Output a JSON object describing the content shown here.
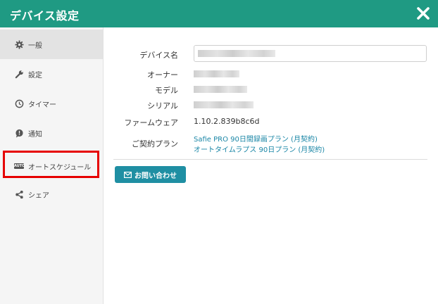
{
  "window": {
    "title": "デバイス設定"
  },
  "sidebar": {
    "items": [
      {
        "label": "一般",
        "icon": "gear-icon",
        "active": true
      },
      {
        "label": "設定",
        "icon": "wrench-icon"
      },
      {
        "label": "タイマー",
        "icon": "clock-icon"
      },
      {
        "label": "通知",
        "icon": "notification-icon"
      },
      {
        "label": "オートスケジュール",
        "icon": "auto-icon",
        "icon_text": "AUTO"
      },
      {
        "label": "シェア",
        "icon": "share-icon"
      }
    ]
  },
  "general": {
    "device_name_label": "デバイス名",
    "owner_label": "オーナー",
    "model_label": "モデル",
    "serial_label": "シリアル",
    "firmware_label": "ファームウェア",
    "firmware_value": "1.10.2.839b8c6d",
    "plan_label": "ご契約プラン",
    "plans": [
      "Safie PRO 90日間録画プラン (月契約)",
      "オートタイムラプス 90日プラン (月契約)"
    ],
    "contact_label": "お問い合わせ"
  },
  "colors": {
    "header": "#1f9a83",
    "button": "#1f8fa3",
    "link": "#1a86a6",
    "highlight": "#e60000"
  }
}
